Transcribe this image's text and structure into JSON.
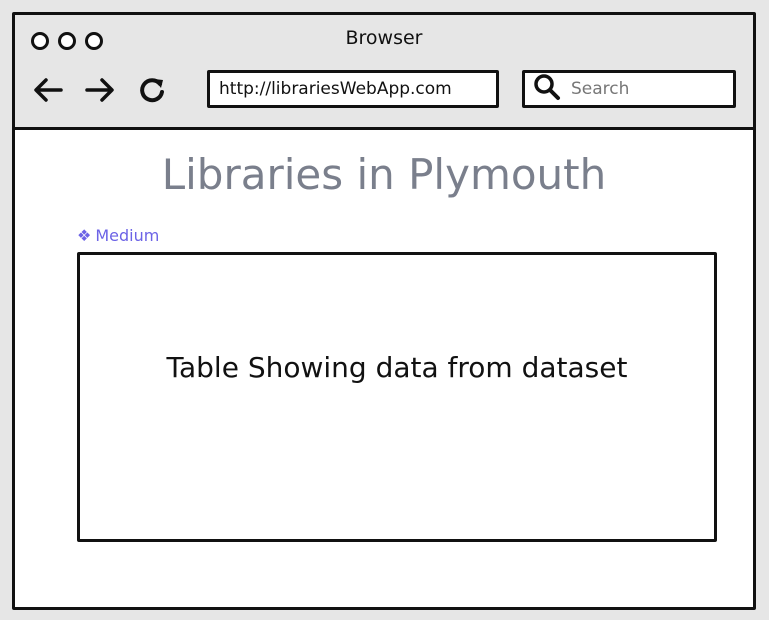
{
  "window": {
    "title": "Browser",
    "controls": [
      "close-dot",
      "minimize-dot",
      "maximize-dot"
    ]
  },
  "toolbar": {
    "back_icon": "arrow-left-icon",
    "forward_icon": "arrow-right-icon",
    "reload_icon": "reload-icon",
    "url": "http://librariesWebApp.com",
    "search_placeholder": "Search",
    "search_icon": "magnifier-icon"
  },
  "page": {
    "heading": "Libraries in Plymouth",
    "badge": {
      "icon": "❖",
      "label": "Medium",
      "color": "#6c63e6"
    },
    "table_placeholder": "Table Showing data from dataset"
  }
}
